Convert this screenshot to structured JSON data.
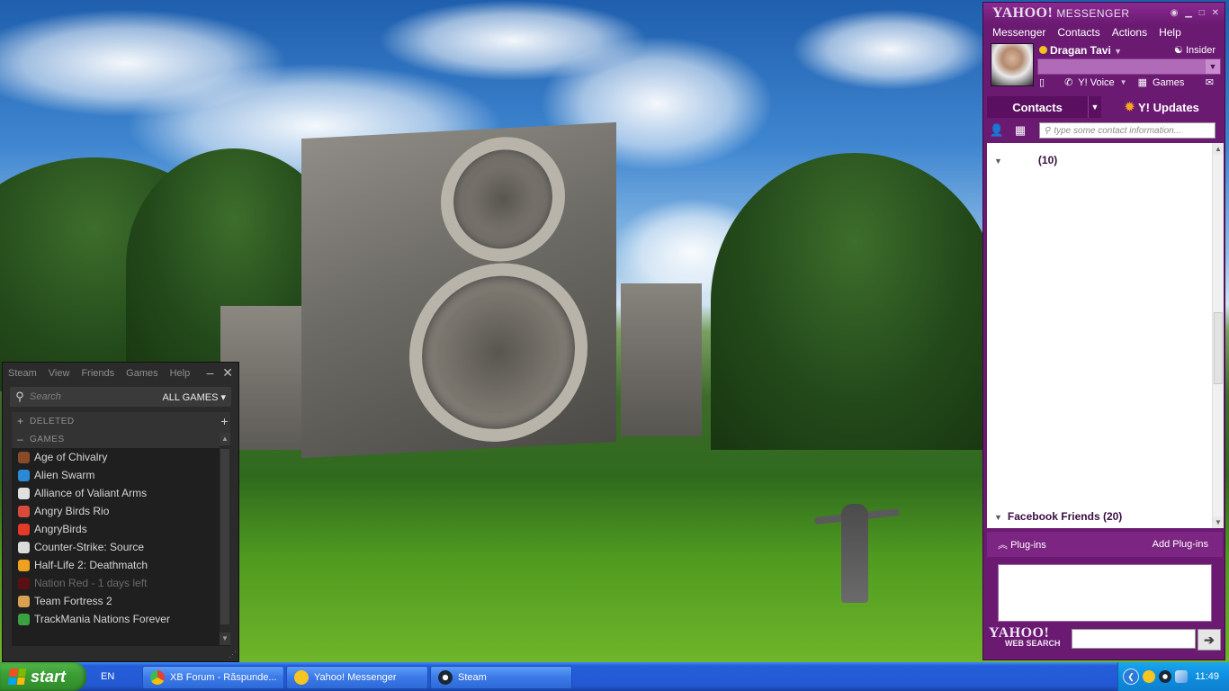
{
  "steam": {
    "menu": [
      "Steam",
      "View",
      "Friends",
      "Games",
      "Help"
    ],
    "search_placeholder": "Search",
    "filter_label": "ALL GAMES",
    "categories": [
      {
        "label": "DELETED",
        "state": "collapsed"
      },
      {
        "label": "GAMES",
        "state": "expanded"
      }
    ],
    "games": [
      {
        "name": "Age of Chivalry",
        "color": "#8a4a2a"
      },
      {
        "name": "Alien Swarm",
        "color": "#2a8ad8"
      },
      {
        "name": "Alliance of Valiant Arms",
        "color": "#e0e0e0"
      },
      {
        "name": "Angry Birds Rio",
        "color": "#d84a3a"
      },
      {
        "name": "AngryBirds",
        "color": "#e33a2a"
      },
      {
        "name": "Counter-Strike: Source",
        "color": "#dcdcdc"
      },
      {
        "name": "Half-Life 2: Deathmatch",
        "color": "#f0a020"
      },
      {
        "name": "Nation Red - 1 days left",
        "color": "#5a1010",
        "dim": true
      },
      {
        "name": "Team Fortress 2",
        "color": "#d8a050"
      },
      {
        "name": "TrackMania Nations Forever",
        "color": "#3aa040"
      }
    ]
  },
  "yahoo": {
    "logo": "YAHOO!",
    "logo_sub": "MESSENGER",
    "menu": [
      "Messenger",
      "Contacts",
      "Actions",
      "Help"
    ],
    "user_name": "Dragan Tavi",
    "insider": "Insider",
    "voice": "Y! Voice",
    "games": "Games",
    "tab_contacts": "Contacts",
    "tab_updates": "Y! Updates",
    "search_placeholder": "type some contact information...",
    "group_1": "(10)",
    "group_2": "Facebook Friends (20)",
    "plugins": "Plug-ins",
    "add_plugins": "Add Plug-ins",
    "web_search_logo": "YAHOO!",
    "web_search_label": "WEB SEARCH"
  },
  "taskbar": {
    "start": "start",
    "lang": "EN",
    "tasks": [
      {
        "label": "XB Forum - Răspunde...",
        "icon_color": "#e34133"
      },
      {
        "label": "Yahoo! Messenger",
        "icon_color": "#f7c520"
      },
      {
        "label": "Steam",
        "icon_color": "#1b2838"
      }
    ],
    "clock": "11:49"
  }
}
